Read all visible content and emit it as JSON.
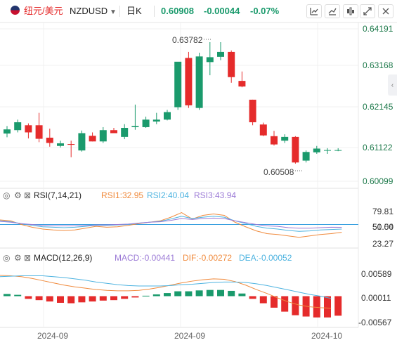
{
  "header": {
    "pair_cn": "纽元/美元",
    "symbol": "NZDUSD",
    "timeframe": "日K",
    "price": "0.60908",
    "change": "-0.00044",
    "change_pct": "-0.07%"
  },
  "colors": {
    "up": "#1a9a6c",
    "down": "#e52b2b",
    "rsi1": "#f08a3c",
    "rsi2": "#4db3e0",
    "rsi3": "#9b7ad6",
    "macd": "#9b7ad6",
    "dif": "#f08a3c",
    "dea": "#4db3e0",
    "axis_text": "#1f7a4c"
  },
  "icons": [
    "chart-type-icon",
    "compare-icon",
    "indicators-icon",
    "fullscreen-icon",
    "settings-icon"
  ],
  "price_axis": [
    "0.64191",
    "0.63168",
    "0.62145",
    "0.61122",
    "0.60099"
  ],
  "annotations": {
    "high": "0.63782",
    "low": "0.60508"
  },
  "rsi": {
    "title": "RSI(7,14,21)",
    "rsi1": "RSI1:32.95",
    "rsi2": "RSI2:40.04",
    "rsi3": "RSI3:43.94",
    "axis": [
      "79.81",
      "50.00",
      "51.54",
      "23.27"
    ]
  },
  "macd": {
    "title": "MACD(12,26,9)",
    "macd": "MACD:-0.00441",
    "dif": "DIF:-0.00272",
    "dea": "DEA:-0.00052",
    "axis": [
      "0.00589",
      "0.00011",
      "-0.00567"
    ]
  },
  "x_axis": [
    "2024-09",
    "2024-09",
    "2024-10"
  ],
  "chart_data": [
    {
      "type": "candlestick",
      "title": "NZDUSD 日K",
      "ylim": [
        0.60099,
        0.64191
      ],
      "candles": [
        {
          "o": 0.6135,
          "h": 0.6155,
          "l": 0.6125,
          "c": 0.6146
        },
        {
          "o": 0.6144,
          "h": 0.6172,
          "l": 0.6138,
          "c": 0.6165
        },
        {
          "o": 0.6157,
          "h": 0.6162,
          "l": 0.6122,
          "c": 0.6138
        },
        {
          "o": 0.6157,
          "h": 0.619,
          "l": 0.6112,
          "c": 0.6121
        },
        {
          "o": 0.6124,
          "h": 0.6148,
          "l": 0.61,
          "c": 0.611
        },
        {
          "o": 0.6102,
          "h": 0.6116,
          "l": 0.6098,
          "c": 0.6109
        },
        {
          "o": 0.6107,
          "h": 0.6116,
          "l": 0.6072,
          "c": 0.6105
        },
        {
          "o": 0.609,
          "h": 0.6143,
          "l": 0.6087,
          "c": 0.6136
        },
        {
          "o": 0.6129,
          "h": 0.6138,
          "l": 0.6114,
          "c": 0.6114
        },
        {
          "o": 0.6114,
          "h": 0.6152,
          "l": 0.611,
          "c": 0.6144
        },
        {
          "o": 0.6144,
          "h": 0.615,
          "l": 0.6136,
          "c": 0.6136
        },
        {
          "o": 0.6126,
          "h": 0.616,
          "l": 0.612,
          "c": 0.615
        },
        {
          "o": 0.6152,
          "h": 0.6212,
          "l": 0.6145,
          "c": 0.6155
        },
        {
          "o": 0.6152,
          "h": 0.618,
          "l": 0.615,
          "c": 0.6172
        },
        {
          "o": 0.6167,
          "h": 0.619,
          "l": 0.616,
          "c": 0.6172
        },
        {
          "o": 0.6172,
          "h": 0.6198,
          "l": 0.617,
          "c": 0.6192
        },
        {
          "o": 0.6205,
          "h": 0.632,
          "l": 0.6198,
          "c": 0.6326
        },
        {
          "o": 0.6336,
          "h": 0.6352,
          "l": 0.6203,
          "c": 0.621
        },
        {
          "o": 0.6203,
          "h": 0.635,
          "l": 0.6198,
          "c": 0.634
        },
        {
          "o": 0.6325,
          "h": 0.6378,
          "l": 0.629,
          "c": 0.6338
        },
        {
          "o": 0.6339,
          "h": 0.6378,
          "l": 0.633,
          "c": 0.6352
        },
        {
          "o": 0.6352,
          "h": 0.6356,
          "l": 0.627,
          "c": 0.6285
        },
        {
          "o": 0.6275,
          "h": 0.63,
          "l": 0.6258,
          "c": 0.626
        },
        {
          "o": 0.6225,
          "h": 0.6225,
          "l": 0.6157,
          "c": 0.6165
        },
        {
          "o": 0.6159,
          "h": 0.6164,
          "l": 0.6128,
          "c": 0.613
        },
        {
          "o": 0.6128,
          "h": 0.6142,
          "l": 0.6103,
          "c": 0.6106
        },
        {
          "o": 0.6116,
          "h": 0.6133,
          "l": 0.611,
          "c": 0.6126
        },
        {
          "o": 0.6126,
          "h": 0.6128,
          "l": 0.6055,
          "c": 0.6058
        },
        {
          "o": 0.6063,
          "h": 0.609,
          "l": 0.6058,
          "c": 0.6086
        },
        {
          "o": 0.6085,
          "h": 0.6102,
          "l": 0.6081,
          "c": 0.6095
        },
        {
          "o": 0.6091,
          "h": 0.6096,
          "l": 0.6081,
          "c": 0.6091
        },
        {
          "o": 0.6091,
          "h": 0.6096,
          "l": 0.6088,
          "c": 0.6091
        }
      ]
    },
    {
      "type": "line",
      "title": "RSI(7,14,21)",
      "ylim": [
        0,
        100
      ],
      "series": [
        {
          "name": "RSI1",
          "values": [
            60,
            58,
            50,
            44,
            40,
            38,
            37,
            38,
            42,
            46,
            44,
            45,
            48,
            52,
            55,
            58,
            66,
            76,
            62,
            70,
            73,
            70,
            55,
            45,
            36,
            30,
            28,
            25,
            22,
            25,
            28,
            30,
            32.95
          ]
        },
        {
          "name": "RSI2",
          "values": [
            58,
            56,
            52,
            48,
            45,
            44,
            43,
            44,
            46,
            48,
            48,
            49,
            50,
            53,
            55,
            57,
            62,
            68,
            63,
            66,
            68,
            66,
            58,
            52,
            46,
            42,
            40,
            37,
            35,
            36,
            38,
            39,
            40.04
          ]
        },
        {
          "name": "RSI3",
          "values": [
            57,
            55,
            52,
            50,
            48,
            47,
            47,
            47,
            48,
            49,
            49,
            50,
            51,
            53,
            55,
            56,
            59,
            63,
            61,
            63,
            64,
            63,
            58,
            54,
            50,
            47,
            46,
            43,
            42,
            42,
            43,
            44,
            43.94
          ]
        }
      ]
    },
    {
      "type": "bar+line",
      "title": "MACD(12,26,9)",
      "ylim": [
        -0.0069,
        0.0069
      ],
      "macd_hist": [
        0.0005,
        0.0003,
        -0.0006,
        -0.0009,
        -0.0012,
        -0.0015,
        -0.0016,
        -0.0014,
        -0.0012,
        -0.001,
        -0.0009,
        -0.0006,
        -0.0003,
        0.0001,
        0.0004,
        0.0007,
        0.0011,
        0.0011,
        0.0013,
        0.0014,
        0.0014,
        0.0012,
        0.0006,
        -0.0006,
        -0.0016,
        -0.0026,
        -0.0035,
        -0.0043,
        -0.0046,
        -0.0048,
        -0.0048,
        -0.00441
      ],
      "series": [
        {
          "name": "DIF",
          "values": [
            0.0047,
            0.0046,
            0.0044,
            0.004,
            0.0035,
            0.003,
            0.0025,
            0.0021,
            0.0018,
            0.0015,
            0.0013,
            0.0012,
            0.0012,
            0.0013,
            0.0016,
            0.002,
            0.0025,
            0.003,
            0.0034,
            0.0037,
            0.0039,
            0.0038,
            0.0033,
            0.0025,
            0.0015,
            0.0006,
            -0.0004,
            -0.0013,
            -0.002,
            -0.0024,
            -0.0026,
            -0.00272
          ]
        },
        {
          "name": "DEA",
          "values": [
            0.0044,
            0.0045,
            0.0046,
            0.0046,
            0.0046,
            0.0044,
            0.0042,
            0.0039,
            0.0036,
            0.0032,
            0.0029,
            0.0026,
            0.0024,
            0.0023,
            0.0023,
            0.0023,
            0.0024,
            0.0026,
            0.0027,
            0.0029,
            0.0031,
            0.0032,
            0.0032,
            0.0031,
            0.0028,
            0.0024,
            0.0019,
            0.0014,
            0.0009,
            0.0004,
            0.0,
            -0.00052
          ]
        }
      ]
    }
  ]
}
